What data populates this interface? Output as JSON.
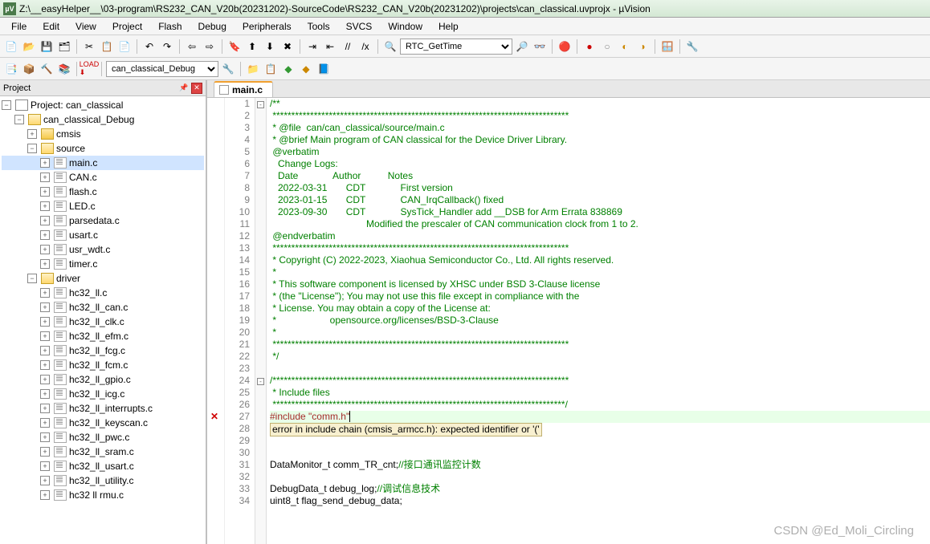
{
  "title": "Z:\\__easyHelper__\\03-program\\RS232_CAN_V20b(20231202)-SourceCode\\RS232_CAN_V20b(20231202)\\projects\\can_classical.uvprojx - µVision",
  "menu": [
    "File",
    "Edit",
    "View",
    "Project",
    "Flash",
    "Debug",
    "Peripherals",
    "Tools",
    "SVCS",
    "Window",
    "Help"
  ],
  "toolbar1_combo": "RTC_GetTime",
  "toolbar2_combo": "can_classical_Debug",
  "project_panel": {
    "title": "Project"
  },
  "tree": {
    "root": "Project: can_classical",
    "target": "can_classical_Debug",
    "groups": [
      {
        "name": "cmsis",
        "open": false,
        "files": []
      },
      {
        "name": "source",
        "open": true,
        "files": [
          "main.c",
          "CAN.c",
          "flash.c",
          "LED.c",
          "parsedata.c",
          "usart.c",
          "usr_wdt.c",
          "timer.c"
        ]
      },
      {
        "name": "driver",
        "open": true,
        "files": [
          "hc32_ll.c",
          "hc32_ll_can.c",
          "hc32_ll_clk.c",
          "hc32_ll_efm.c",
          "hc32_ll_fcg.c",
          "hc32_ll_fcm.c",
          "hc32_ll_gpio.c",
          "hc32_ll_icg.c",
          "hc32_ll_interrupts.c",
          "hc32_ll_keyscan.c",
          "hc32_ll_pwc.c",
          "hc32_ll_sram.c",
          "hc32_ll_usart.c",
          "hc32_ll_utility.c",
          "hc32 ll rmu.c"
        ]
      }
    ]
  },
  "tab": {
    "label": "main.c"
  },
  "code": {
    "lines": [
      {
        "n": 1,
        "fold": "-",
        "cls": "c-comment",
        "t": "/**"
      },
      {
        "n": 2,
        "cls": "c-comment",
        "t": " *******************************************************************************"
      },
      {
        "n": 3,
        "cls": "c-comment",
        "t": " * @file  can/can_classical/source/main.c"
      },
      {
        "n": 4,
        "cls": "c-comment",
        "t": " * @brief Main program of CAN classical for the Device Driver Library."
      },
      {
        "n": 5,
        "cls": "c-comment",
        "t": " @verbatim"
      },
      {
        "n": 6,
        "cls": "c-comment",
        "t": "   Change Logs:"
      },
      {
        "n": 7,
        "cls": "c-comment",
        "t": "   Date             Author          Notes"
      },
      {
        "n": 8,
        "cls": "c-comment",
        "t": "   2022-03-31       CDT             First version"
      },
      {
        "n": 9,
        "cls": "c-comment",
        "t": "   2023-01-15       CDT             CAN_IrqCallback() fixed"
      },
      {
        "n": 10,
        "cls": "c-comment",
        "t": "   2023-09-30       CDT             SysTick_Handler add __DSB for Arm Errata 838869"
      },
      {
        "n": 11,
        "cls": "c-comment",
        "t": "                                    Modified the prescaler of CAN communication clock from 1 to 2."
      },
      {
        "n": 12,
        "cls": "c-comment",
        "t": " @endverbatim"
      },
      {
        "n": 13,
        "cls": "c-comment",
        "t": " *******************************************************************************"
      },
      {
        "n": 14,
        "cls": "c-comment",
        "t": " * Copyright (C) 2022-2023, Xiaohua Semiconductor Co., Ltd. All rights reserved."
      },
      {
        "n": 15,
        "cls": "c-comment",
        "t": " *"
      },
      {
        "n": 16,
        "cls": "c-comment",
        "t": " * This software component is licensed by XHSC under BSD 3-Clause license"
      },
      {
        "n": 17,
        "cls": "c-comment",
        "t": " * (the \"License\"); You may not use this file except in compliance with the"
      },
      {
        "n": 18,
        "cls": "c-comment",
        "t": " * License. You may obtain a copy of the License at:"
      },
      {
        "n": 19,
        "cls": "c-comment",
        "t": " *                    opensource.org/licenses/BSD-3-Clause"
      },
      {
        "n": 20,
        "cls": "c-comment",
        "t": " *"
      },
      {
        "n": 21,
        "cls": "c-comment",
        "t": " *******************************************************************************"
      },
      {
        "n": 22,
        "cls": "c-comment",
        "t": " */"
      },
      {
        "n": 23,
        "cls": "",
        "t": ""
      },
      {
        "n": 24,
        "fold": "-",
        "cls": "c-comment",
        "t": "/*******************************************************************************"
      },
      {
        "n": 25,
        "cls": "c-comment",
        "t": " * Include files"
      },
      {
        "n": 26,
        "cls": "c-comment",
        "t": " ******************************************************************************/"
      },
      {
        "n": 27,
        "mark": "x",
        "hl": true,
        "seg": [
          {
            "cls": "c-include",
            "t": "#include "
          },
          {
            "cls": "c-string",
            "t": "\"comm.h\""
          },
          {
            "cls": "cursor",
            "t": ""
          }
        ]
      },
      {
        "n": 28,
        "err": true,
        "t": "error in include chain (cmsis_armcc.h): expected identifier or '('"
      },
      {
        "n": 29,
        "cls": "",
        "t": ""
      },
      {
        "n": 30,
        "cls": "",
        "t": ""
      },
      {
        "n": 31,
        "seg": [
          {
            "cls": "",
            "t": "DataMonitor_t comm_TR_cnt;"
          },
          {
            "cls": "c-chinese",
            "t": "//接口通讯监控计数"
          }
        ]
      },
      {
        "n": 32,
        "cls": "",
        "t": ""
      },
      {
        "n": 33,
        "seg": [
          {
            "cls": "",
            "t": "DebugData_t debug_log;"
          },
          {
            "cls": "c-chinese",
            "t": "//调试信息技术"
          }
        ]
      },
      {
        "n": 34,
        "cls": "",
        "t": "uint8_t flag_send_debug_data;"
      }
    ]
  },
  "watermark": "CSDN @Ed_Moli_Circling"
}
